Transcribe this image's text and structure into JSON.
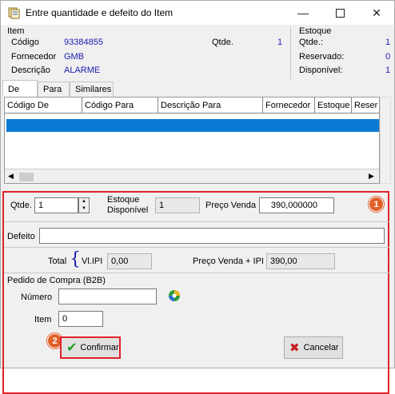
{
  "window": {
    "title": "Entre quantidade e defeito do Item"
  },
  "item_group": {
    "heading": "Item",
    "codigo_label": "Código",
    "codigo_value": "93384855",
    "fornecedor_label": "Fornecedor",
    "fornecedor_value": "GMB",
    "descricao_label": "Descrição",
    "descricao_value": "ALARME",
    "qtde_label": "Qtde.",
    "qtde_value": "1"
  },
  "estoque_group": {
    "heading": "Estoque",
    "qtde_label": "Qtde.:",
    "qtde_value": "1",
    "reservado_label": "Reservado:",
    "reservado_value": "0",
    "disponivel_label": "Disponível:",
    "disponivel_value": "1"
  },
  "tabs": [
    "De",
    "Para",
    "Similares"
  ],
  "grid": {
    "columns": [
      "Código De",
      "Código Para",
      "Descrição Para",
      "Fornecedor",
      "Estoque",
      "Reser"
    ]
  },
  "form": {
    "qtde_label": "Qtde.",
    "qtde_value": "1",
    "estoque_disp_label_1": "Estoque",
    "estoque_disp_label_2": "Disponível",
    "estoque_disp_value": "1",
    "preco_venda_label": "Preço Venda",
    "preco_venda_value": "390,000000",
    "defeito_label": "Defeito",
    "defeito_value": "",
    "total_label": "Total",
    "vl_ipi_label": "Vl.IPI",
    "vl_ipi_value": "0,00",
    "preco_ipi_label": "Preço Venda + IPI",
    "preco_ipi_value": "390,00",
    "pedido_heading": "Pedido de Compra (B2B)",
    "numero_label": "Número",
    "numero_value": "",
    "item_label": "Item",
    "item_value": "0"
  },
  "badges": {
    "one": "1",
    "two": "2"
  },
  "buttons": {
    "confirmar": "Confirmar",
    "cancelar": "Cancelar"
  },
  "colors": {
    "highlight": "#e0222a",
    "badge": "#e0602a",
    "selection": "#0a79d4",
    "value_blue": "#1a1ab3"
  }
}
